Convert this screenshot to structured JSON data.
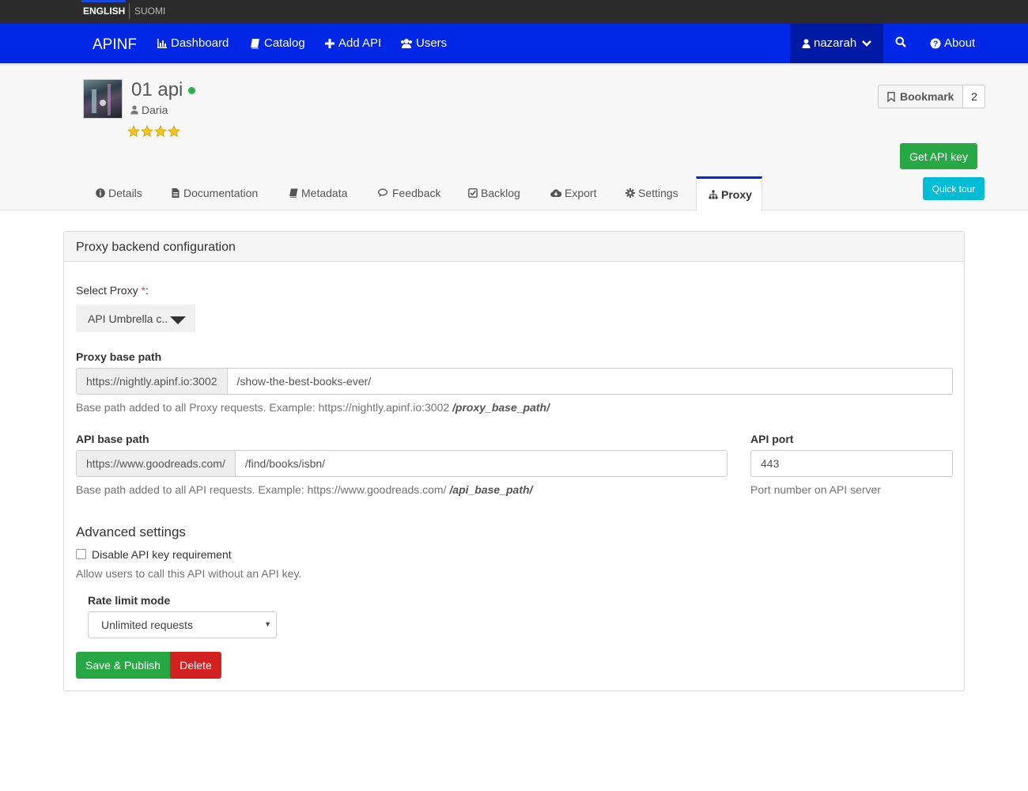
{
  "languages": {
    "english": "ENGLISH",
    "suomi": "SUOMI"
  },
  "navbar": {
    "brand": "APINF",
    "items": [
      {
        "label": "Dashboard",
        "icon": "bar-chart-icon"
      },
      {
        "label": "Catalog",
        "icon": "book-icon"
      },
      {
        "label": "Add API",
        "icon": "plus-icon"
      },
      {
        "label": "Users",
        "icon": "users-icon"
      }
    ],
    "user": "nazarah",
    "about": "About",
    "accent": "#0026e6"
  },
  "api": {
    "title": "01 api",
    "owner": "Daria",
    "rating": 4,
    "status_color": "#2bb24c"
  },
  "actions": {
    "bookmark": "Bookmark",
    "bookmark_count": "2",
    "get_api_key": "Get API key",
    "quick_tour": "Quick tour"
  },
  "tabs": [
    {
      "label": "Details",
      "icon": "info-icon"
    },
    {
      "label": "Documentation",
      "icon": "file-icon"
    },
    {
      "label": "Metadata",
      "icon": "book-icon"
    },
    {
      "label": "Feedback",
      "icon": "comments-icon"
    },
    {
      "label": "Backlog",
      "icon": "check-square-icon"
    },
    {
      "label": "Export",
      "icon": "cloud-download-icon"
    },
    {
      "label": "Settings",
      "icon": "gear-icon"
    },
    {
      "label": "Proxy",
      "icon": "sitemap-icon",
      "active": true
    }
  ],
  "panel": {
    "title": "Proxy backend configuration",
    "select_proxy": {
      "label": "Select Proxy",
      "required": "*",
      "colon": ":",
      "value": "API Umbrella c.."
    },
    "proxy_base_path": {
      "label": "Proxy base path",
      "prefix": "https://nightly.apinf.io:3002",
      "value": "/show-the-best-books-ever/",
      "help": "Base path added to all Proxy requests. Example:  https://nightly.apinf.io:3002",
      "help_bold": "/proxy_base_path/"
    },
    "api_base_path": {
      "label": "API base path",
      "prefix": "https://www.goodreads.com/",
      "value": "/find/books/isbn/",
      "help": "Base path added to all API requests. Example:  https://www.goodreads.com/",
      "help_bold": "/api_base_path/"
    },
    "api_port": {
      "label": "API port",
      "value": "443",
      "help": "Port number on API server"
    },
    "advanced": {
      "title": "Advanced settings",
      "disable_key_label": "Disable API key requirement",
      "disable_key_checked": false,
      "disable_key_help": "Allow users to call this API without an API key.",
      "rate_limit_label": "Rate limit mode",
      "rate_limit_value": "Unlimited requests"
    },
    "save": "Save & Publish",
    "delete": "Delete"
  }
}
